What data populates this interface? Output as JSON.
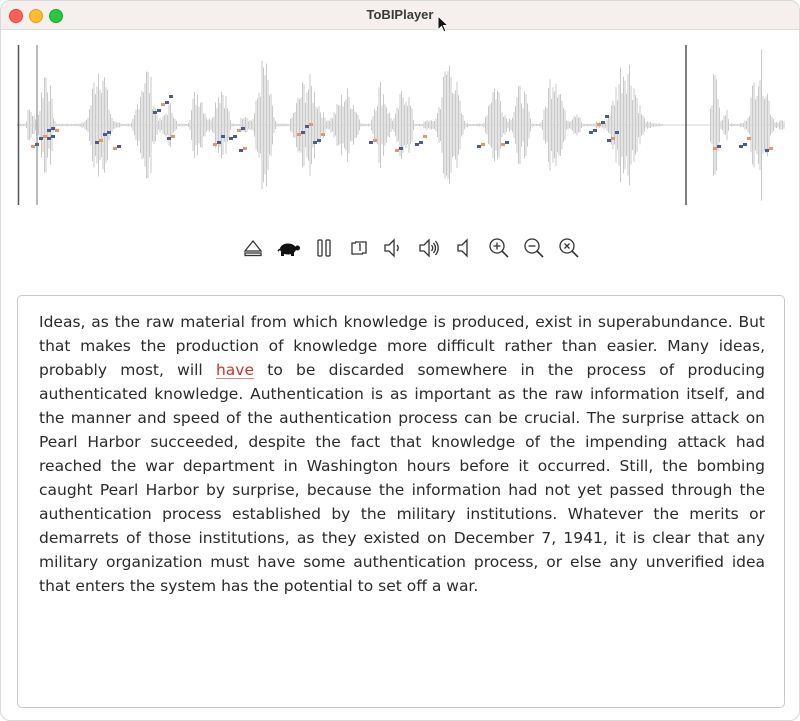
{
  "window": {
    "title": "ToBIPlayer"
  },
  "waveform": {
    "wave_color": "#c9c9c9",
    "pitch_blue": "#4a5d8a",
    "pitch_orange": "#e8956a"
  },
  "toolbar": {
    "buttons": [
      {
        "name": "eject-button",
        "icon": "eject-icon"
      },
      {
        "name": "slow-playback-button",
        "icon": "turtle-icon"
      },
      {
        "name": "pause-button",
        "icon": "pause-icon"
      },
      {
        "name": "loop-button",
        "icon": "loop-icon"
      },
      {
        "name": "volume-down-button",
        "icon": "speaker-low-icon"
      },
      {
        "name": "volume-up-button",
        "icon": "speaker-high-icon"
      },
      {
        "name": "mute-button",
        "icon": "speaker-mute-icon"
      },
      {
        "name": "zoom-in-button",
        "icon": "zoom-in-icon"
      },
      {
        "name": "zoom-out-button",
        "icon": "zoom-out-icon"
      },
      {
        "name": "zoom-reset-button",
        "icon": "zoom-reset-icon"
      }
    ]
  },
  "transcript": {
    "before": "Ideas, as the raw material from which knowledge is produced, exist in superabundance. But that makes the production of knowledge more difficult rather than easier. Many ideas, probably most, will ",
    "highlighted_word": "have",
    "after": " to be discarded somewhere in the process of producing authenticated knowledge. Authentication is as important as the raw information itself, and the manner and speed of the authentication process can be crucial. The surprise attack on Pearl Harbor succeeded, despite the fact that knowledge of the impending attack had reached the war department in Washington hours before it occurred. Still, the bombing caught Pearl Harbor by surprise, because the information had not yet passed through the authentication process established by the military institutions. Whatever the merits or demarrets of those institutions, as they existed on December 7, 1941, it is clear that any military organization must have some authentication process, or else any unverified idea that enters the system has the potential to set off a war."
  }
}
